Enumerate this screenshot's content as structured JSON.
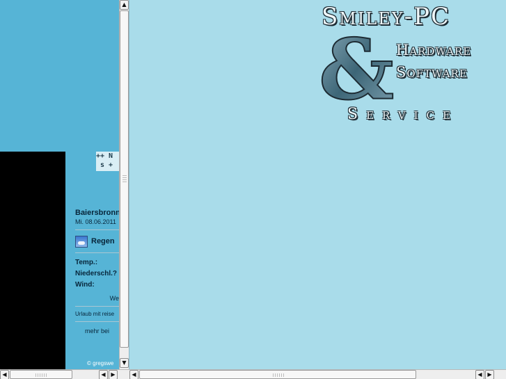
{
  "left": {
    "news_ticker": {
      "line1": "++ N",
      "line2": " s +"
    },
    "weather": {
      "city": "Baiersbronn",
      "date": "Mi. 08.06.2011",
      "condition": "Regen",
      "temp_label": "Temp.:",
      "precip_label": "Niederschl.?",
      "wind_label": "Wind:",
      "more": "We",
      "vacation": "Urlaub mit reise",
      "mehr": "mehr bei",
      "credit": "© gregswe"
    }
  },
  "logo": {
    "title": "Smiley-PC",
    "ampersand": "&",
    "line1": "Hardware",
    "line2": "Software",
    "service": "Service"
  },
  "scrollbars": {
    "up_arrow": "▲",
    "down_arrow": "▼",
    "left_arrow": "◀",
    "right_arrow": "▶"
  },
  "colors": {
    "left_bg": "#56b4d6",
    "right_bg": "#a9dcea",
    "black_block": "#000000"
  }
}
